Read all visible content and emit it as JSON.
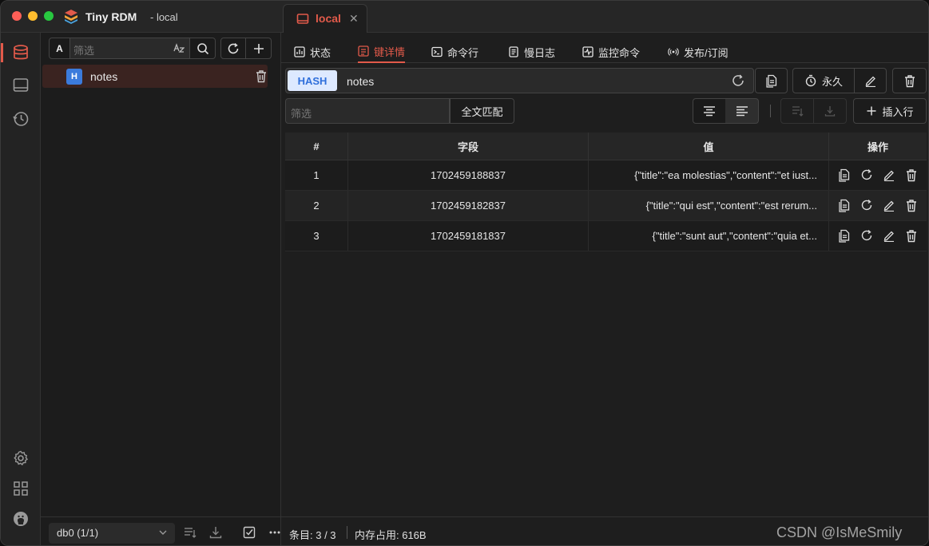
{
  "window": {
    "app_title": "Tiny RDM",
    "app_subtitle": "- local",
    "tab_label": "local",
    "colors": {
      "accent": "#e25a4a",
      "hash_badge_bg": "#dde9ff",
      "hash_badge_fg": "#2f6fdb",
      "key_type_bg": "#3b7bdc"
    }
  },
  "sidebar": {
    "filter_toggle": "A",
    "filter_placeholder": "筛选",
    "keys": [
      {
        "type": "H",
        "name": "notes"
      }
    ],
    "db_select": "db0 (1/1)"
  },
  "nav": {
    "tabs": [
      {
        "label": "状态",
        "icon": "status-icon"
      },
      {
        "label": "键详情",
        "icon": "key-detail-icon",
        "active": true
      },
      {
        "label": "命令行",
        "icon": "terminal-icon"
      },
      {
        "label": "慢日志",
        "icon": "slowlog-icon"
      },
      {
        "label": "监控命令",
        "icon": "monitor-icon"
      },
      {
        "label": "发布/订阅",
        "icon": "pubsub-icon"
      }
    ]
  },
  "key_detail": {
    "type": "HASH",
    "key_name": "notes",
    "ttl_label": "永久",
    "value_filter_placeholder": "筛选",
    "fulltext_button": "全文匹配",
    "insert_row_button": "插入行"
  },
  "table": {
    "headers": [
      "#",
      "字段",
      "值",
      "操作"
    ],
    "rows": [
      {
        "index": "1",
        "field": "1702459188837",
        "value": "{\"title\":\"ea molestias\",\"content\":\"et iust..."
      },
      {
        "index": "2",
        "field": "1702459182837",
        "value": "{\"title\":\"qui est\",\"content\":\"est rerum..."
      },
      {
        "index": "3",
        "field": "1702459181837",
        "value": "{\"title\":\"sunt aut\",\"content\":\"quia et..."
      }
    ]
  },
  "status": {
    "entries": "条目: 3 / 3",
    "memory": "内存占用: 616B",
    "watermark": "CSDN @IsMeSmily"
  }
}
